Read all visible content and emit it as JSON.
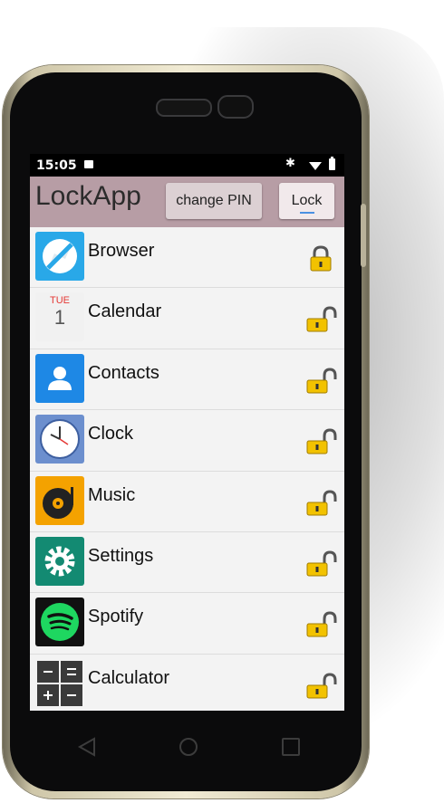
{
  "status_bar": {
    "time": "15:05",
    "bluetooth_glyph": "✱"
  },
  "app": {
    "title": "LockApp",
    "change_pin_label": "change PIN",
    "lock_label": "Lock",
    "accent_color": "#b79da5"
  },
  "apps": [
    {
      "name": "Browser",
      "icon": "browser-icon",
      "locked": true
    },
    {
      "name": "Calendar",
      "icon": "calendar-icon",
      "locked": false,
      "icon_day": "TUE",
      "icon_date": "1"
    },
    {
      "name": "Contacts",
      "icon": "contacts-icon",
      "locked": false
    },
    {
      "name": "Clock",
      "icon": "clock-icon",
      "locked": false
    },
    {
      "name": "Music",
      "icon": "music-icon",
      "locked": false
    },
    {
      "name": "Settings",
      "icon": "settings-icon",
      "locked": false
    },
    {
      "name": "Spotify",
      "icon": "spotify-icon",
      "locked": false
    },
    {
      "name": "Calculator",
      "icon": "calculator-icon",
      "locked": false
    }
  ]
}
